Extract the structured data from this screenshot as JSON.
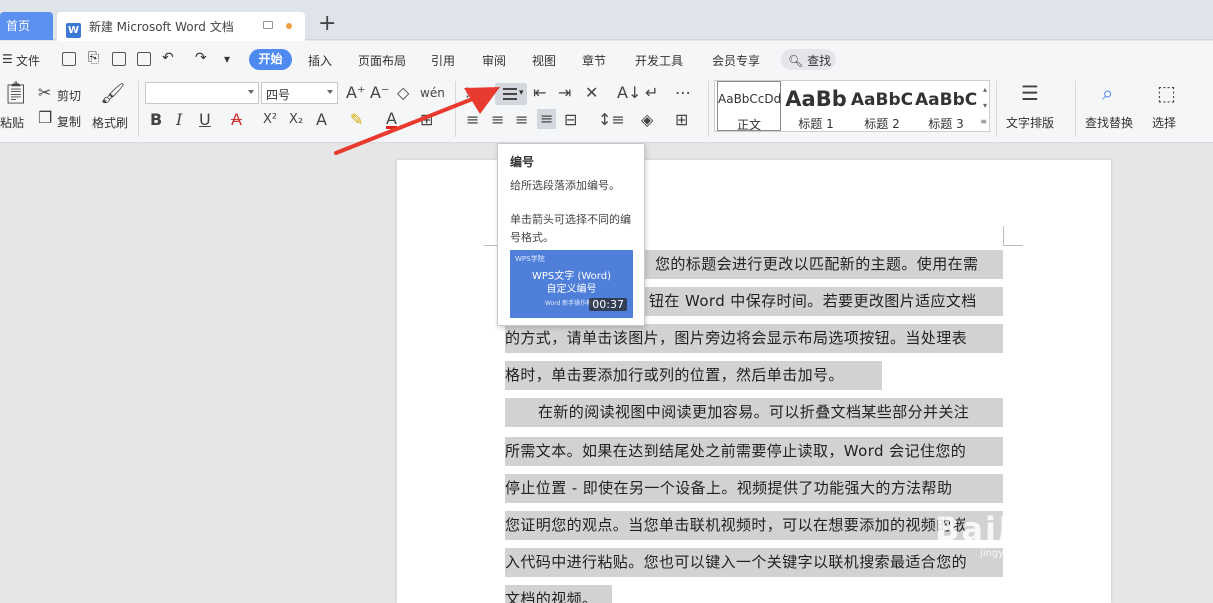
{
  "tabs": {
    "home": "首页",
    "document": "新建 Microsoft Word 文档",
    "doc_icon_letter": "W",
    "add": "+"
  },
  "menu": {
    "file": "文件",
    "items": [
      "开始",
      "插入",
      "页面布局",
      "引用",
      "审阅",
      "视图",
      "章节",
      "开发工具",
      "会员专享"
    ],
    "search": "查找"
  },
  "ribbon": {
    "paste": "粘贴",
    "cut": "剪切",
    "copy": "复制",
    "format_painter": "格式刷",
    "font_name": "",
    "font_size": "四号",
    "bold": "B",
    "italic": "I",
    "underline": "U",
    "styles": [
      {
        "preview": "AaBbCcDd",
        "label": "正文"
      },
      {
        "preview": "AaBb",
        "label": "标题 1"
      },
      {
        "preview": "AaBbC",
        "label": "标题 2"
      },
      {
        "preview": "AaBbC",
        "label": "标题 3"
      }
    ],
    "text_layout": "文字排版",
    "find_replace": "查找替换",
    "select": "选择"
  },
  "tooltip": {
    "title": "编号",
    "desc": "给所选段落添加编号。",
    "hint": "单击箭头可选择不同的编号格式。",
    "video_logo": "WPS学院",
    "video_title_1": "WPS文字 (Word)",
    "video_title_2": "自定义编号",
    "video_sub": "Word 新手操作教程",
    "video_duration": "00:37"
  },
  "document": {
    "lines": [
      "您的标题会进行更改以匹配新的主题。使用在需",
      "钮在 Word 中保存时间。若要更改图片适应文档",
      "的方式，请单击该图片，图片旁边将会显示布局选项按钮。当处理表",
      "格时，单击要添加行或列的位置，然后单击加号。",
      "在新的阅读视图中阅读更加容易。可以折叠文档某些部分并关注",
      "所需文本。如果在达到结尾处之前需要停止读取，Word 会记住您的",
      "停止位置 - 即使在另一个设备上。视频提供了功能强大的方法帮助",
      "您证明您的观点。当您单击联机视频时，可以在想要添加的视频的嵌",
      "入代码中进行粘贴。您也可以键入一个关键字以联机搜索最适合您的",
      "文档的视频。"
    ]
  },
  "watermark": {
    "text": "Bai度经验",
    "url": "jingyan.baidu.com"
  },
  "colors": {
    "accent": "#4e8af0",
    "arrow": "#e83a2f",
    "selection": "#d2d2d2"
  }
}
